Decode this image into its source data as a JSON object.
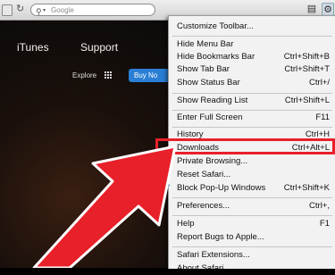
{
  "toolbar": {
    "search_placeholder": "Google"
  },
  "site_nav": {
    "itunes": "iTunes",
    "support": "Support",
    "explore": "Explore",
    "buy": "Buy No"
  },
  "menu": {
    "items": [
      {
        "label": "Customize Toolbar...",
        "shortcut": ""
      },
      {
        "label": "Hide Menu Bar",
        "shortcut": ""
      },
      {
        "label": "Hide Bookmarks Bar",
        "shortcut": "Ctrl+Shift+B"
      },
      {
        "label": "Show Tab Bar",
        "shortcut": "Ctrl+Shift+T"
      },
      {
        "label": "Show Status Bar",
        "shortcut": "Ctrl+/"
      },
      {
        "label": "Show Reading List",
        "shortcut": "Ctrl+Shift+L"
      },
      {
        "label": "Enter Full Screen",
        "shortcut": "F11"
      },
      {
        "label": "History",
        "shortcut": "Ctrl+H"
      },
      {
        "label": "Downloads",
        "shortcut": "Ctrl+Alt+L"
      },
      {
        "label": "Private Browsing...",
        "shortcut": ""
      },
      {
        "label": "Reset Safari...",
        "shortcut": ""
      },
      {
        "label": "Block Pop-Up Windows",
        "shortcut": "Ctrl+Shift+K"
      },
      {
        "label": "Preferences...",
        "shortcut": "Ctrl+,"
      },
      {
        "label": "Help",
        "shortcut": "F1"
      },
      {
        "label": "Report Bugs to Apple...",
        "shortcut": ""
      },
      {
        "label": "Safari Extensions...",
        "shortcut": ""
      },
      {
        "label": "About Safari",
        "shortcut": ""
      }
    ],
    "highlight_color": "#e8202a",
    "arrow_color": "#e8202a"
  }
}
